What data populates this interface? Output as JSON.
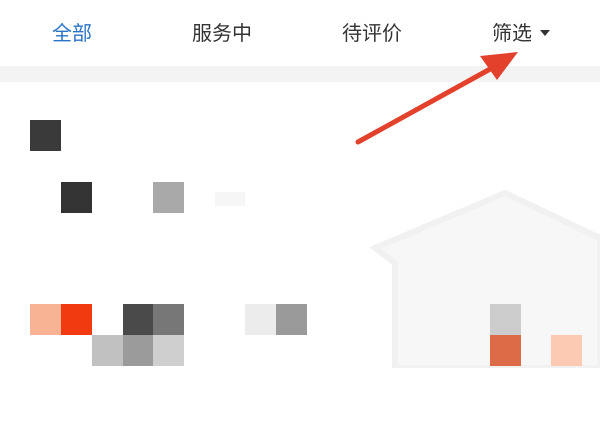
{
  "tabs": {
    "all": "全部",
    "serving": "服务中",
    "review": "待评价",
    "filter": "筛选"
  },
  "colors": {
    "active_tab": "#2a73c8",
    "tab_text": "#333333",
    "arrow": "#e3412c",
    "separator": "#f3f3f3"
  },
  "icons": {
    "filter_dropdown": "caret-down-icon",
    "pointer": "red-arrow"
  }
}
